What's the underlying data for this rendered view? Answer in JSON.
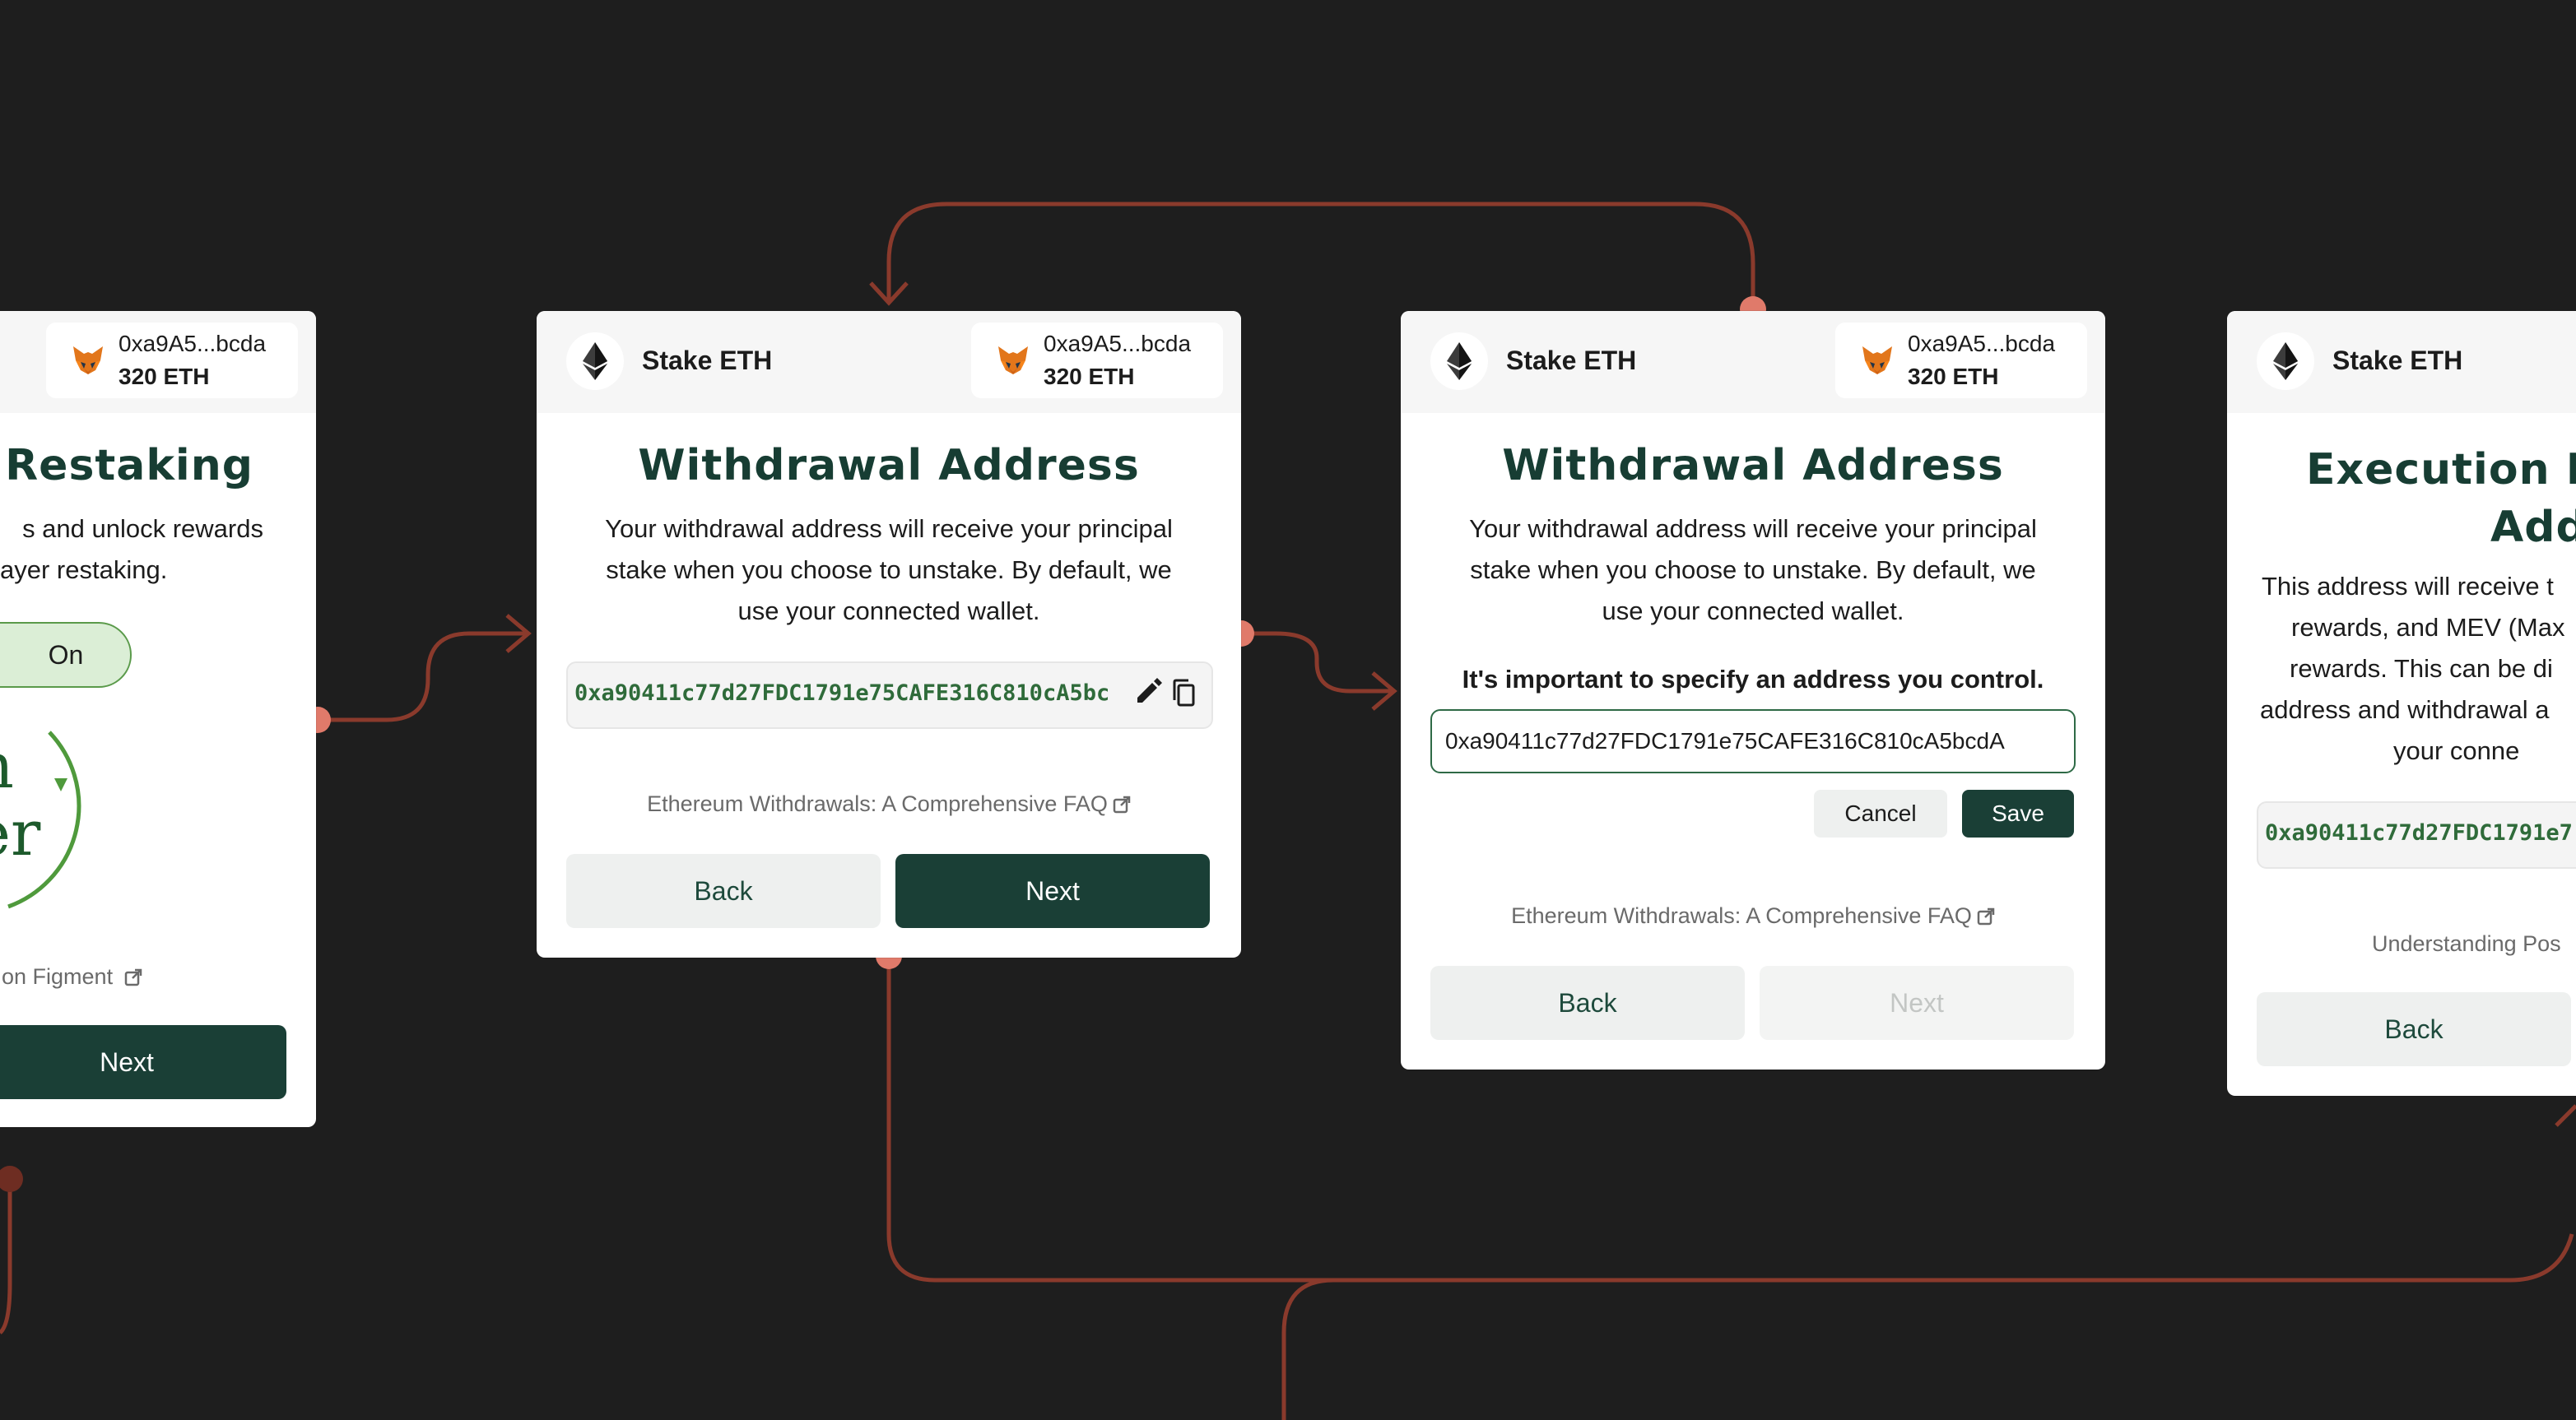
{
  "wallet": {
    "address": "0xa9A5...bcda",
    "balance": "320 ETH"
  },
  "header": {
    "title": "Stake ETH"
  },
  "card1": {
    "title": "Restaking",
    "desc_line1": "s and unlock rewards",
    "desc_line2": "ayer restaking.",
    "toggle_label": "On",
    "badge_line1": "n",
    "badge_line2": "er",
    "link": "on Figment",
    "next": "Next"
  },
  "card2": {
    "title": "Withdrawal Address",
    "desc_line1": "Your withdrawal address will receive your principal",
    "desc_line2": "stake when you choose to unstake. By default, we",
    "desc_line3": "use your connected wallet.",
    "address": "0xa90411c77d27FDC1791e75CAFE316C810cA5bc",
    "faq": "Ethereum Withdrawals: A Comprehensive FAQ",
    "back": "Back",
    "next": "Next"
  },
  "card3": {
    "title": "Withdrawal Address",
    "desc_line1": "Your withdrawal address will receive your principal",
    "desc_line2": "stake when you choose to unstake. By default, we",
    "desc_line3": "use your connected wallet.",
    "important": "It's important to specify an address you control.",
    "input_value": "0xa90411c77d27FDC1791e75CAFE316C810cA5bcdA",
    "cancel": "Cancel",
    "save": "Save",
    "faq": "Ethereum Withdrawals: A Comprehensive FAQ",
    "back": "Back",
    "next": "Next"
  },
  "card4": {
    "title_line1": "Execution La",
    "title_line2": "Add",
    "desc_line1": "This address will receive t",
    "desc_line2": "rewards, and MEV (Max",
    "desc_line3": "rewards. This can be di",
    "desc_line4": "address and withdrawal a",
    "desc_line5": "your conne",
    "address": "0xa90411c77d27FDC1791e7",
    "link": "Understanding Pos",
    "back": "Back"
  },
  "colors": {
    "background": "#1e1e1e",
    "connector": "#8a3a2c",
    "connector_dot": "#e07a6a",
    "primary": "#1a3f36",
    "accent_green": "#2f6b3a"
  },
  "icons": [
    "ethereum-icon",
    "metamask-fox-icon",
    "pencil-icon",
    "copy-icon",
    "external-link-icon",
    "arrow-head-icon"
  ]
}
